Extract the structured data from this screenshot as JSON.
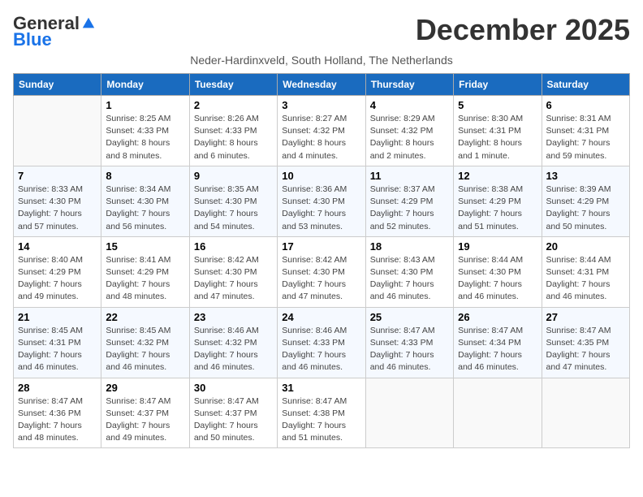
{
  "header": {
    "logo_general": "General",
    "logo_blue": "Blue",
    "month": "December 2025",
    "subtitle": "Neder-Hardinxveld, South Holland, The Netherlands"
  },
  "days_of_week": [
    "Sunday",
    "Monday",
    "Tuesday",
    "Wednesday",
    "Thursday",
    "Friday",
    "Saturday"
  ],
  "weeks": [
    [
      {
        "day": "",
        "info": ""
      },
      {
        "day": "1",
        "info": "Sunrise: 8:25 AM\nSunset: 4:33 PM\nDaylight: 8 hours\nand 8 minutes."
      },
      {
        "day": "2",
        "info": "Sunrise: 8:26 AM\nSunset: 4:33 PM\nDaylight: 8 hours\nand 6 minutes."
      },
      {
        "day": "3",
        "info": "Sunrise: 8:27 AM\nSunset: 4:32 PM\nDaylight: 8 hours\nand 4 minutes."
      },
      {
        "day": "4",
        "info": "Sunrise: 8:29 AM\nSunset: 4:32 PM\nDaylight: 8 hours\nand 2 minutes."
      },
      {
        "day": "5",
        "info": "Sunrise: 8:30 AM\nSunset: 4:31 PM\nDaylight: 8 hours\nand 1 minute."
      },
      {
        "day": "6",
        "info": "Sunrise: 8:31 AM\nSunset: 4:31 PM\nDaylight: 7 hours\nand 59 minutes."
      }
    ],
    [
      {
        "day": "7",
        "info": "Sunrise: 8:33 AM\nSunset: 4:30 PM\nDaylight: 7 hours\nand 57 minutes."
      },
      {
        "day": "8",
        "info": "Sunrise: 8:34 AM\nSunset: 4:30 PM\nDaylight: 7 hours\nand 56 minutes."
      },
      {
        "day": "9",
        "info": "Sunrise: 8:35 AM\nSunset: 4:30 PM\nDaylight: 7 hours\nand 54 minutes."
      },
      {
        "day": "10",
        "info": "Sunrise: 8:36 AM\nSunset: 4:30 PM\nDaylight: 7 hours\nand 53 minutes."
      },
      {
        "day": "11",
        "info": "Sunrise: 8:37 AM\nSunset: 4:29 PM\nDaylight: 7 hours\nand 52 minutes."
      },
      {
        "day": "12",
        "info": "Sunrise: 8:38 AM\nSunset: 4:29 PM\nDaylight: 7 hours\nand 51 minutes."
      },
      {
        "day": "13",
        "info": "Sunrise: 8:39 AM\nSunset: 4:29 PM\nDaylight: 7 hours\nand 50 minutes."
      }
    ],
    [
      {
        "day": "14",
        "info": "Sunrise: 8:40 AM\nSunset: 4:29 PM\nDaylight: 7 hours\nand 49 minutes."
      },
      {
        "day": "15",
        "info": "Sunrise: 8:41 AM\nSunset: 4:29 PM\nDaylight: 7 hours\nand 48 minutes."
      },
      {
        "day": "16",
        "info": "Sunrise: 8:42 AM\nSunset: 4:30 PM\nDaylight: 7 hours\nand 47 minutes."
      },
      {
        "day": "17",
        "info": "Sunrise: 8:42 AM\nSunset: 4:30 PM\nDaylight: 7 hours\nand 47 minutes."
      },
      {
        "day": "18",
        "info": "Sunrise: 8:43 AM\nSunset: 4:30 PM\nDaylight: 7 hours\nand 46 minutes."
      },
      {
        "day": "19",
        "info": "Sunrise: 8:44 AM\nSunset: 4:30 PM\nDaylight: 7 hours\nand 46 minutes."
      },
      {
        "day": "20",
        "info": "Sunrise: 8:44 AM\nSunset: 4:31 PM\nDaylight: 7 hours\nand 46 minutes."
      }
    ],
    [
      {
        "day": "21",
        "info": "Sunrise: 8:45 AM\nSunset: 4:31 PM\nDaylight: 7 hours\nand 46 minutes."
      },
      {
        "day": "22",
        "info": "Sunrise: 8:45 AM\nSunset: 4:32 PM\nDaylight: 7 hours\nand 46 minutes."
      },
      {
        "day": "23",
        "info": "Sunrise: 8:46 AM\nSunset: 4:32 PM\nDaylight: 7 hours\nand 46 minutes."
      },
      {
        "day": "24",
        "info": "Sunrise: 8:46 AM\nSunset: 4:33 PM\nDaylight: 7 hours\nand 46 minutes."
      },
      {
        "day": "25",
        "info": "Sunrise: 8:47 AM\nSunset: 4:33 PM\nDaylight: 7 hours\nand 46 minutes."
      },
      {
        "day": "26",
        "info": "Sunrise: 8:47 AM\nSunset: 4:34 PM\nDaylight: 7 hours\nand 46 minutes."
      },
      {
        "day": "27",
        "info": "Sunrise: 8:47 AM\nSunset: 4:35 PM\nDaylight: 7 hours\nand 47 minutes."
      }
    ],
    [
      {
        "day": "28",
        "info": "Sunrise: 8:47 AM\nSunset: 4:36 PM\nDaylight: 7 hours\nand 48 minutes."
      },
      {
        "day": "29",
        "info": "Sunrise: 8:47 AM\nSunset: 4:37 PM\nDaylight: 7 hours\nand 49 minutes."
      },
      {
        "day": "30",
        "info": "Sunrise: 8:47 AM\nSunset: 4:37 PM\nDaylight: 7 hours\nand 50 minutes."
      },
      {
        "day": "31",
        "info": "Sunrise: 8:47 AM\nSunset: 4:38 PM\nDaylight: 7 hours\nand 51 minutes."
      },
      {
        "day": "",
        "info": ""
      },
      {
        "day": "",
        "info": ""
      },
      {
        "day": "",
        "info": ""
      }
    ]
  ]
}
